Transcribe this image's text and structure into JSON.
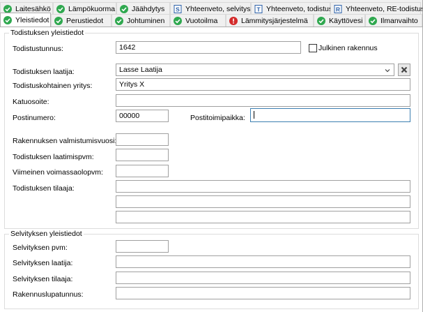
{
  "tabs_row1": [
    {
      "label": "Laitesähkö",
      "icon": "check-circle-icon"
    },
    {
      "label": "Lämpökuorma",
      "icon": "check-circle-icon"
    },
    {
      "label": "Jäähdytys",
      "icon": "check-circle-icon"
    },
    {
      "label": "Yhteenveto, selvitys",
      "icon": "document-s-icon"
    },
    {
      "label": "Yhteenveto, todistus",
      "icon": "document-t-icon"
    },
    {
      "label": "Yhteenveto, RE-todistus",
      "icon": "document-r-icon"
    }
  ],
  "tabs_row2": [
    {
      "label": "Yleistiedot",
      "icon": "check-circle-icon"
    },
    {
      "label": "Perustiedot",
      "icon": "check-circle-icon"
    },
    {
      "label": "Johtuminen",
      "icon": "check-circle-icon"
    },
    {
      "label": "Vuotoilma",
      "icon": "check-circle-icon"
    },
    {
      "label": "Lämmitysjärjestelmä",
      "icon": "error-circle-icon"
    },
    {
      "label": "Käyttövesi",
      "icon": "check-circle-icon"
    },
    {
      "label": "Ilmanvaihto",
      "icon": "check-circle-icon"
    }
  ],
  "colors": {
    "ok": "#2fa84f",
    "error": "#d42b2b",
    "doc": "#2a5fa8",
    "focus": "#3c7fb1"
  },
  "certificate": {
    "group_title": "Todistuksen yleistiedot",
    "todistustunnus_label": "Todistustunnus:",
    "todistustunnus_value": "1642",
    "public_building_label": "Julkinen rakennus",
    "public_building_checked": false,
    "laatija_label": "Todistuksen laatija:",
    "laatija_value": "Lasse Laatija",
    "yritys_label": "Todistuskohtainen yritys:",
    "yritys_value": "Yritys X",
    "katuosoite_label": "Katuosoite:",
    "katuosoite_value": "",
    "postinumero_label": "Postinumero:",
    "postinumero_value": "00000",
    "postitoimipaikka_label": "Postitoimipaikka:",
    "postitoimipaikka_value": "",
    "valmistumisvuosi_label": "Rakennuksen valmistumisvuosi:",
    "laatimispvm_label": "Todistuksen laatimispvm:",
    "voimassaolopvm_label": "Viimeinen voimassaolopvm:",
    "tilaaja_label": "Todistuksen tilaaja:"
  },
  "survey": {
    "group_title": "Selvityksen yleistiedot",
    "pvm_label": "Selvityksen pvm:",
    "laatija_label": "Selvityksen laatija:",
    "tilaaja_label": "Selvityksen tilaaja:",
    "lupatunnus_label": "Rakennuslupatunnus:"
  }
}
